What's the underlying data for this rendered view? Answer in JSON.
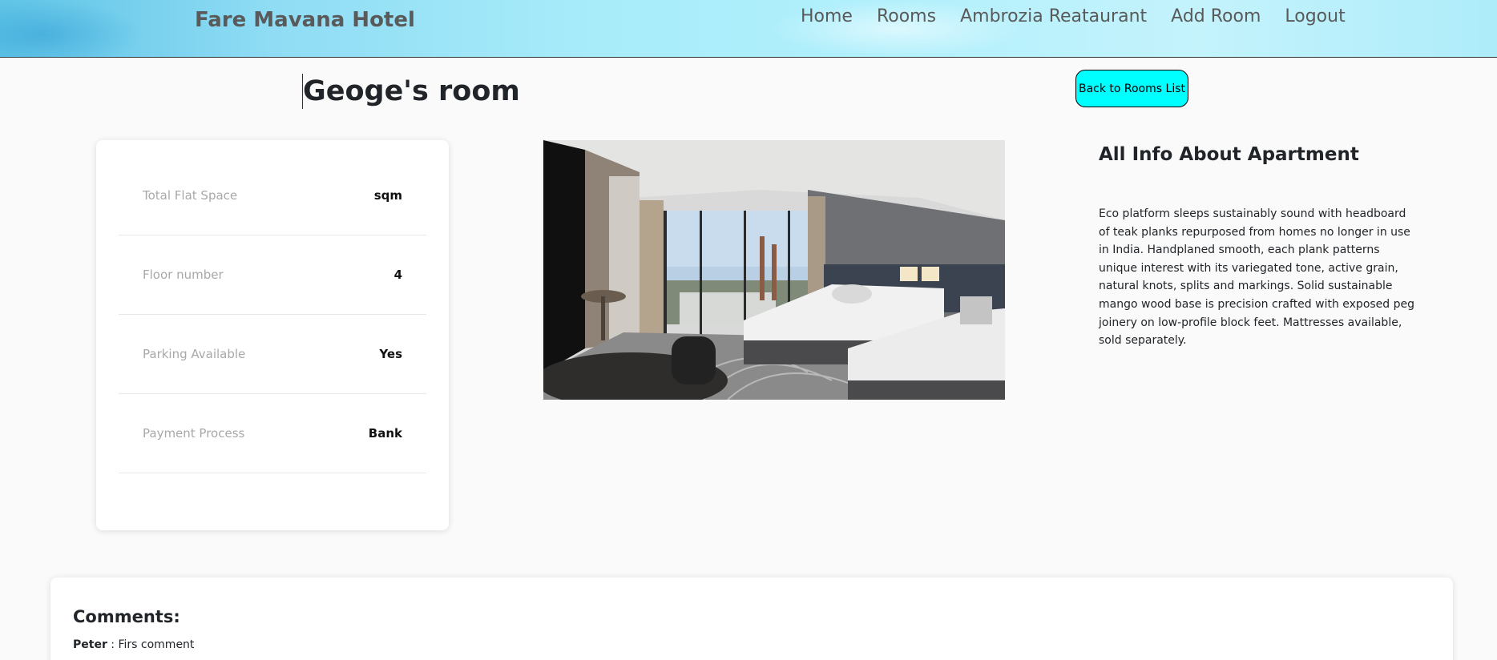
{
  "header": {
    "brand": "Fare Mavana Hotel",
    "nav": [
      {
        "label": "Home"
      },
      {
        "label": "Rooms"
      },
      {
        "label": "Ambrozia Reataurant"
      },
      {
        "label": "Add Room"
      },
      {
        "label": "Logout"
      }
    ]
  },
  "room": {
    "title": "Geoge's room",
    "back_button": "Back to Rooms List"
  },
  "info": [
    {
      "label": "Total Flat Space",
      "value": "sqm"
    },
    {
      "label": "Floor number",
      "value": "4"
    },
    {
      "label": "Parking Available",
      "value": "Yes"
    },
    {
      "label": "Payment Process",
      "value": "Bank"
    }
  ],
  "description": {
    "title": "All Info About Apartment",
    "text": "Eco platform sleeps sustainably sound with headboard of teak planks repurposed from homes no longer in use in India. Handplaned smooth, each plank patterns unique interest with its variegated tone, active grain, natural knots, splits and markings. Solid sustainable mango wood base is precision crafted with exposed peg joinery on low-profile block feet. Mattresses available, sold separately."
  },
  "comments": {
    "title": "Comments:",
    "items": [
      {
        "author": "Peter",
        "separator": " : ",
        "text": "Firs comment"
      }
    ]
  },
  "colors": {
    "back_button_bg": "#00ffff",
    "brand_text": "#5a5a5a"
  }
}
